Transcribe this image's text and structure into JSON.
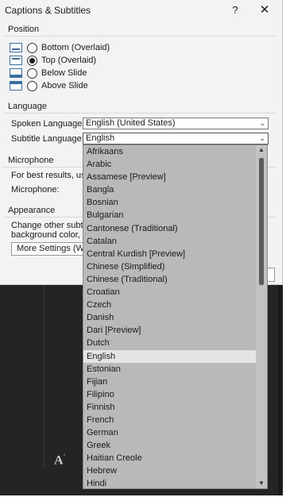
{
  "dialog": {
    "title": "Captions & Subtitles",
    "help_glyph": "?",
    "close_glyph": "✕"
  },
  "position": {
    "heading": "Position",
    "options": [
      {
        "label": "Bottom (Overlaid)",
        "checked": false
      },
      {
        "label": "Top (Overlaid)",
        "checked": true
      },
      {
        "label": "Below Slide",
        "checked": false
      },
      {
        "label": "Above Slide",
        "checked": false
      }
    ]
  },
  "language": {
    "heading": "Language",
    "spoken_label": "Spoken Language:",
    "spoken_value": "English (United States)",
    "subtitle_label": "Subtitle Language:",
    "subtitle_value": "English"
  },
  "microphone": {
    "heading": "Microphone",
    "hint": "For best results, use",
    "label": "Microphone:"
  },
  "appearance": {
    "heading": "Appearance",
    "line1": "Change other subtitl",
    "line2": "background color, an",
    "button_label": "More Settings (Win"
  },
  "dropdown": {
    "selected": "English",
    "items": [
      "Afrikaans",
      "Arabic",
      "Assamese [Preview]",
      "Bangla",
      "Bosnian",
      "Bulgarian",
      "Cantonese (Traditional)",
      "Catalan",
      "Central Kurdish [Preview]",
      "Chinese (Simplified)",
      "Chinese (Traditional)",
      "Croatian",
      "Czech",
      "Danish",
      "Dari [Preview]",
      "Dutch",
      "English",
      "Estonian",
      "Fijian",
      "Filipino",
      "Finnish",
      "French",
      "German",
      "Greek",
      "Haitian Creole",
      "Hebrew",
      "Hindi"
    ]
  },
  "colors": {
    "dialog_bg": "#f3f3f3",
    "dropdown_bg": "#b9b9b9",
    "selected_bg": "#e4e4e4",
    "backdrop": "#252423"
  }
}
